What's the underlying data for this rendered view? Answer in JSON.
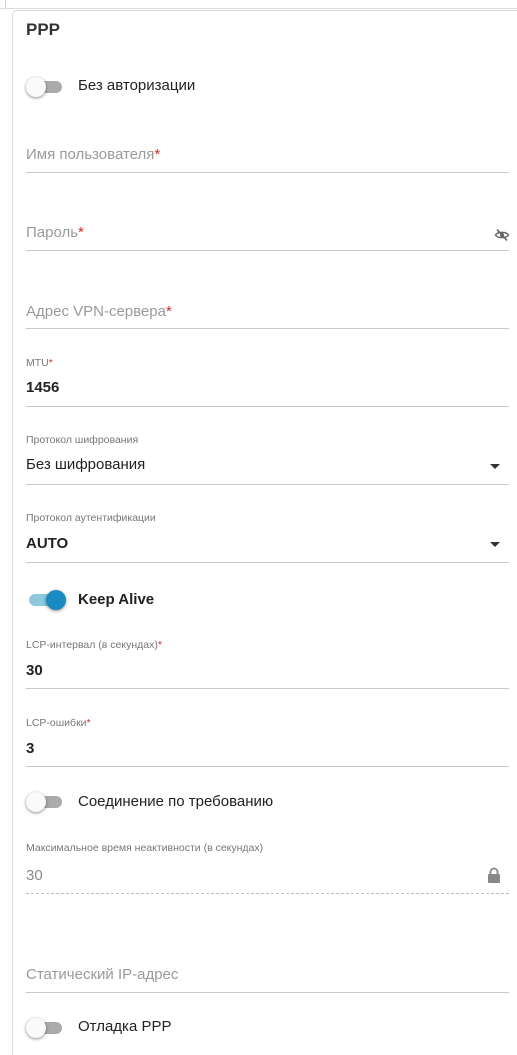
{
  "section": {
    "title": "PPP"
  },
  "no_auth": {
    "label": "Без авторизации",
    "enabled": false
  },
  "username": {
    "placeholder": "Имя пользователя",
    "required_mark": "*",
    "value": ""
  },
  "password": {
    "placeholder": "Пароль",
    "required_mark": "*",
    "value": "",
    "toggle_icon": "eye-slash-icon"
  },
  "vpn_server": {
    "placeholder": "Адрес VPN-сервера",
    "required_mark": "*",
    "value": ""
  },
  "mtu": {
    "label": "MTU",
    "required_mark": "*",
    "value": "1456"
  },
  "encryption": {
    "label": "Протокол шифрования",
    "selected": "Без шифрования"
  },
  "auth_protocol": {
    "label": "Протокол аутентификации",
    "selected": "AUTO"
  },
  "keep_alive": {
    "label": "Keep Alive",
    "enabled": true
  },
  "lcp_interval": {
    "label": "LCP-интервал (в секундах)",
    "required_mark": "*",
    "value": "30"
  },
  "lcp_failures": {
    "label": "LCP-ошибки",
    "required_mark": "*",
    "value": "3"
  },
  "dial_on_demand": {
    "label": "Соединение по требованию",
    "enabled": false
  },
  "max_idle": {
    "label": "Максимальное время неактивности (в секундах)",
    "value": "30",
    "icon": "lock-icon"
  },
  "static_ip": {
    "placeholder": "Статический IP-адрес",
    "value": ""
  },
  "ppp_debug": {
    "label": "Отладка PPP",
    "enabled": false
  },
  "colors": {
    "accent": "#1a8bc0",
    "required": "#d62c2c",
    "toggle_off": "#ababab"
  }
}
